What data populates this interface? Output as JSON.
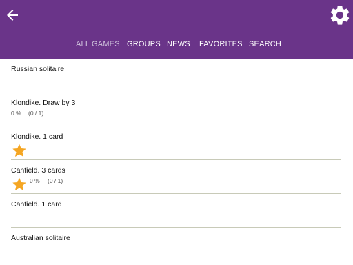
{
  "header": {
    "back_icon": "arrow-left-icon",
    "settings_icon": "gear-icon",
    "background_color": "#6a3489"
  },
  "tabs": [
    {
      "label": "ALL GAMES",
      "active": true
    },
    {
      "label": "GROUPS",
      "active": false
    },
    {
      "label": "NEWS",
      "active": false
    },
    {
      "label": "FAVORITES",
      "active": false
    },
    {
      "label": "SEARCH",
      "active": false
    }
  ],
  "games": [
    {
      "title": "Russian solitaire"
    },
    {
      "title": "Klondike. Draw by 3",
      "percent": "0 %",
      "record": "(0 / 1)"
    },
    {
      "title": "Klondike. 1 card",
      "favorite": true
    },
    {
      "title": "Canfield. 3 cards",
      "favorite": true,
      "percent": "0 %",
      "record": "(0 / 1)"
    },
    {
      "title": "Canfield. 1 card"
    },
    {
      "title": "Australian solitaire"
    }
  ],
  "star_color": "#f5a623"
}
